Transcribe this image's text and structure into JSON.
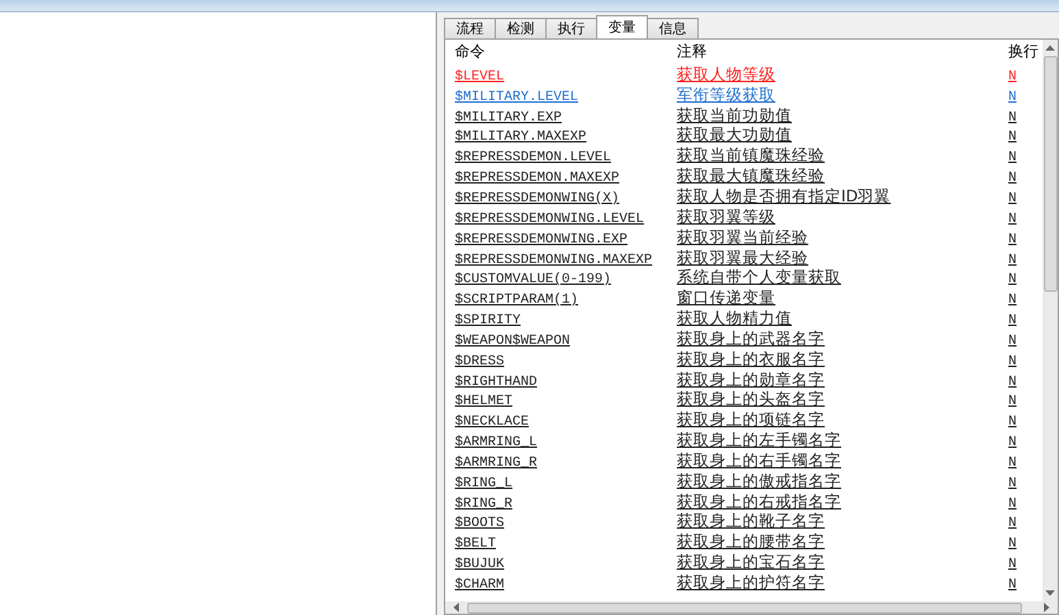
{
  "tabs": [
    {
      "label": "流程",
      "selected": false
    },
    {
      "label": "检测",
      "selected": false
    },
    {
      "label": "执行",
      "selected": false
    },
    {
      "label": "变量",
      "selected": true
    },
    {
      "label": "信息",
      "selected": false
    }
  ],
  "table": {
    "columns": [
      "命令",
      "注释",
      "换行"
    ],
    "rows": [
      {
        "command": "$LEVEL",
        "note": "获取人物等级",
        "wrap": "N",
        "color": "#ff2020"
      },
      {
        "command": "$MILITARY.LEVEL",
        "note": "军衔等级获取",
        "wrap": "N",
        "color": "#1f6fd0"
      },
      {
        "command": "$MILITARY.EXP",
        "note": "获取当前功勋值",
        "wrap": "N",
        "color": "#222222"
      },
      {
        "command": "$MILITARY.MAXEXP",
        "note": "获取最大功勋值",
        "wrap": "N",
        "color": "#222222"
      },
      {
        "command": "$REPRESSDEMON.LEVEL",
        "note": "获取当前镇魔珠经验",
        "wrap": "N",
        "color": "#222222"
      },
      {
        "command": "$REPRESSDEMON.MAXEXP",
        "note": "获取最大镇魔珠经验",
        "wrap": "N",
        "color": "#222222"
      },
      {
        "command": "$REPRESSDEMONWING(X)",
        "note": "获取人物是否拥有指定ID羽翼",
        "wrap": "N",
        "color": "#222222"
      },
      {
        "command": "$REPRESSDEMONWING.LEVEL",
        "note": "获取羽翼等级",
        "wrap": "N",
        "color": "#222222"
      },
      {
        "command": "$REPRESSDEMONWING.EXP",
        "note": "获取羽翼当前经验",
        "wrap": "N",
        "color": "#222222"
      },
      {
        "command": "$REPRESSDEMONWING.MAXEXP",
        "note": "获取羽翼最大经验",
        "wrap": "N",
        "color": "#222222"
      },
      {
        "command": "$CUSTOMVALUE(0-199)",
        "note": "系统自带个人变量获取",
        "wrap": "N",
        "color": "#222222"
      },
      {
        "command": "$SCRIPTPARAM(1)",
        "note": "窗口传递变量",
        "wrap": "N",
        "color": "#222222"
      },
      {
        "command": "$SPIRITY",
        "note": "获取人物精力值",
        "wrap": "N",
        "color": "#222222"
      },
      {
        "command": "$WEAPON$WEAPON",
        "note": "获取身上的武器名字",
        "wrap": "N",
        "color": "#222222"
      },
      {
        "command": "$DRESS",
        "note": "获取身上的衣服名字",
        "wrap": "N",
        "color": "#222222"
      },
      {
        "command": "$RIGHTHAND",
        "note": "获取身上的勋章名字",
        "wrap": "N",
        "color": "#222222"
      },
      {
        "command": "$HELMET",
        "note": "获取身上的头盔名字",
        "wrap": "N",
        "color": "#222222"
      },
      {
        "command": "$NECKLACE",
        "note": "获取身上的项链名字",
        "wrap": "N",
        "color": "#222222"
      },
      {
        "command": "$ARMRING_L",
        "note": "获取身上的左手镯名字",
        "wrap": "N",
        "color": "#222222"
      },
      {
        "command": "$ARMRING_R",
        "note": "获取身上的右手镯名字",
        "wrap": "N",
        "color": "#222222"
      },
      {
        "command": "$RING_L",
        "note": "获取身上的傲戒指名字",
        "wrap": "N",
        "color": "#222222"
      },
      {
        "command": "$RING_R",
        "note": "获取身上的右戒指名字",
        "wrap": "N",
        "color": "#222222"
      },
      {
        "command": "$BOOTS",
        "note": "获取身上的靴子名字",
        "wrap": "N",
        "color": "#222222"
      },
      {
        "command": "$BELT",
        "note": "获取身上的腰带名字",
        "wrap": "N",
        "color": "#222222"
      },
      {
        "command": "$BUJUK",
        "note": "获取身上的宝石名字",
        "wrap": "N",
        "color": "#222222"
      },
      {
        "command": "$CHARM",
        "note": "获取身上的护符名字",
        "wrap": "N",
        "color": "#222222"
      }
    ]
  }
}
